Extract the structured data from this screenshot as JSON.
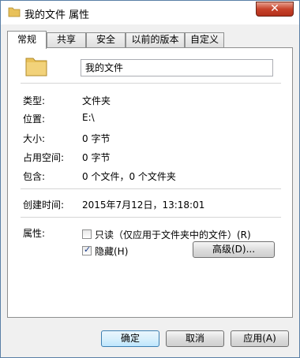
{
  "window": {
    "title": "我的文件 属性",
    "close_glyph": "✕"
  },
  "tabs": [
    {
      "label": "常规"
    },
    {
      "label": "共享"
    },
    {
      "label": "安全"
    },
    {
      "label": "以前的版本"
    },
    {
      "label": "自定义"
    }
  ],
  "general": {
    "folder_icon": "folder-icon",
    "name_value": "我的文件",
    "rows": {
      "type_label": "类型:",
      "type_value": "文件夹",
      "location_label": "位置:",
      "location_value": "E:\\",
      "size_label": "大小:",
      "size_value": "0 字节",
      "disk_label": "占用空间:",
      "disk_value": "0 字节",
      "contains_label": "包含:",
      "contains_value": "0 个文件，0 个文件夹",
      "created_label": "创建时间:",
      "created_value": "2015年7月12日，13:18:01"
    },
    "attributes": {
      "label": "属性:",
      "readonly_label": "只读（仅应用于文件夹中的文件）(R)",
      "readonly_checked": false,
      "hidden_label": "隐藏(H)",
      "hidden_checked": true,
      "advanced_button": "高级(D)..."
    }
  },
  "buttons": {
    "ok": "确定",
    "cancel": "取消",
    "apply": "应用(A)"
  },
  "colors": {
    "window_border": "#5a7fa6",
    "close_red": "#c7432b",
    "folder_yellow": "#e8c15a"
  }
}
